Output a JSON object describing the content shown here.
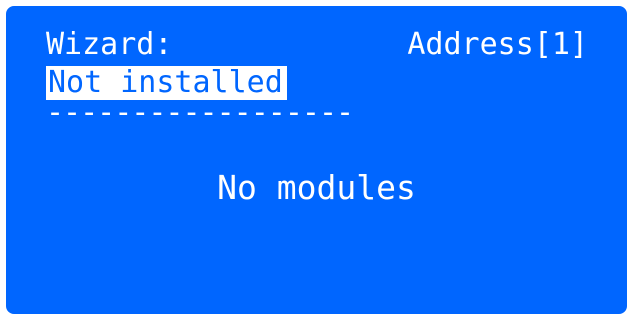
{
  "display": {
    "wizard_label": "Wizard:",
    "address_label": "Address[1]",
    "status": "Not installed",
    "divider": "------------------",
    "message": "No modules",
    "colors": {
      "background": "#0066ff",
      "text": "#ffffff"
    }
  }
}
